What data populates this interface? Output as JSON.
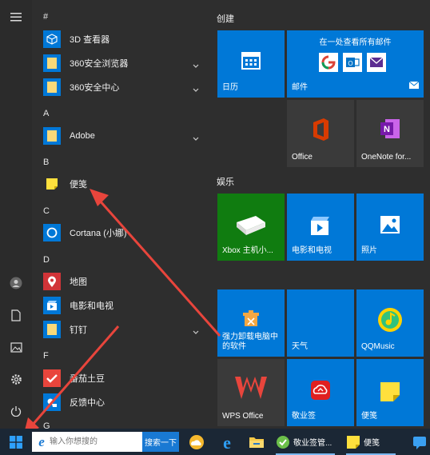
{
  "left_rail": {
    "items": [
      "menu-icon",
      "user-icon",
      "document-icon",
      "pictures-icon",
      "settings-icon",
      "power-icon"
    ]
  },
  "app_list": {
    "sections": [
      {
        "letter": "#",
        "apps": [
          {
            "label": "3D 查看器",
            "icon": "3d-viewer-icon",
            "expandable": false
          },
          {
            "label": "360安全浏览器",
            "icon": "folder-icon",
            "expandable": true
          },
          {
            "label": "360安全中心",
            "icon": "folder-icon",
            "expandable": true
          }
        ]
      },
      {
        "letter": "A",
        "apps": [
          {
            "label": "Adobe",
            "icon": "folder-icon",
            "expandable": true
          }
        ]
      },
      {
        "letter": "B",
        "apps": [
          {
            "label": "便笺",
            "icon": "sticky-notes-icon",
            "expandable": false
          }
        ]
      },
      {
        "letter": "C",
        "apps": [
          {
            "label": "Cortana (小娜)",
            "icon": "cortana-icon",
            "expandable": false
          }
        ]
      },
      {
        "letter": "D",
        "apps": [
          {
            "label": "地图",
            "icon": "maps-icon",
            "expandable": false
          },
          {
            "label": "电影和电视",
            "icon": "movies-tv-icon",
            "expandable": false
          },
          {
            "label": "钉钉",
            "icon": "folder-icon",
            "expandable": true
          }
        ]
      },
      {
        "letter": "F",
        "apps": [
          {
            "label": "番茄土豆",
            "icon": "tomato-icon",
            "expandable": false
          },
          {
            "label": "反馈中心",
            "icon": "feedback-icon",
            "expandable": false
          }
        ]
      },
      {
        "letter": "G",
        "apps": []
      }
    ]
  },
  "tiles": {
    "groups": [
      "创建",
      "娱乐"
    ],
    "items": [
      {
        "label": "日历"
      },
      {
        "label": "邮件",
        "header": "在一处查看所有邮件"
      },
      {
        "label": "Office"
      },
      {
        "label": "OneNote for..."
      },
      {
        "label": "Xbox 主机小..."
      },
      {
        "label": "电影和电视"
      },
      {
        "label": "照片"
      },
      {
        "label": "强力卸载电脑中的软件"
      },
      {
        "label": "天气"
      },
      {
        "label": "QQMusic"
      },
      {
        "label": "WPS Office"
      },
      {
        "label": "敬业签"
      },
      {
        "label": "便笺"
      }
    ]
  },
  "taskbar": {
    "search_placeholder": "输入你想搜的",
    "search_button": "搜索一下",
    "apps": [
      {
        "label": "",
        "icon": "weather-app-icon"
      },
      {
        "label": "",
        "icon": "edge-icon"
      },
      {
        "label": "",
        "icon": "file-explorer-icon"
      },
      {
        "label": "敬业签管...",
        "icon": "jingyeqian-icon"
      },
      {
        "label": "便笺",
        "icon": "sticky-notes-icon"
      },
      {
        "label": "",
        "icon": "chat-app-icon"
      }
    ]
  },
  "colors": {
    "accent": "#0078d7",
    "xbox": "#107c10",
    "arrow": "#e8453c",
    "taskbar": "#1b2735"
  }
}
